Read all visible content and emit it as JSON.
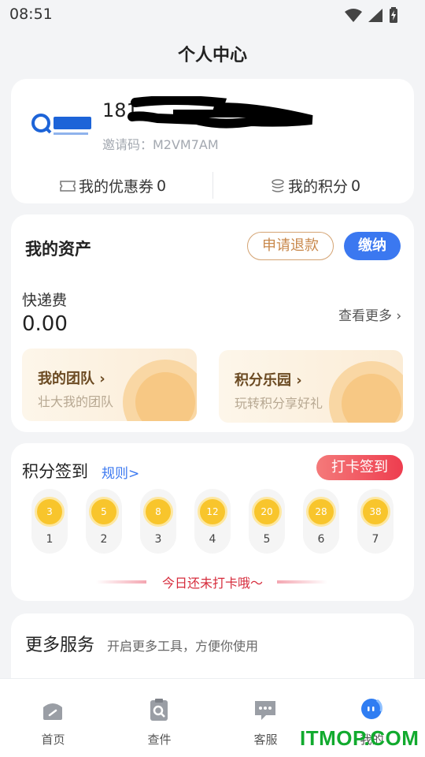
{
  "status_bar": {
    "time": "08:51",
    "icons": [
      "wifi-icon",
      "signal-icon",
      "battery-charging-icon"
    ]
  },
  "page": {
    "title": "个人中心"
  },
  "profile": {
    "phone": "181",
    "invite_code": "邀请码：M2VM7AM",
    "logo_icon": "qbida-logo",
    "coupon_label": "我的优惠券",
    "coupon_count": "0",
    "points_label": "我的积分",
    "points_count": "0"
  },
  "assets": {
    "title": "我的资产",
    "refund_button": "申请退款",
    "pay_button": "缴纳",
    "fee_label": "快递费",
    "fee_value": "0.00",
    "see_more": "查看更多",
    "promos": [
      {
        "title": "我的团队",
        "subtitle": "壮大我的团队"
      },
      {
        "title": "积分乐园",
        "subtitle": "玩转积分享好礼"
      }
    ]
  },
  "checkin": {
    "title": "积分签到",
    "rules_link": "规则>",
    "button": "打卡签到",
    "days": [
      {
        "points": "3",
        "day": "1"
      },
      {
        "points": "5",
        "day": "2"
      },
      {
        "points": "8",
        "day": "3"
      },
      {
        "points": "12",
        "day": "4"
      },
      {
        "points": "20",
        "day": "5"
      },
      {
        "points": "28",
        "day": "6"
      },
      {
        "points": "38",
        "day": "7"
      }
    ],
    "message": "今日还未打卡哦～"
  },
  "services": {
    "title": "更多服务",
    "subtitle": "开启更多工具，方便你使用"
  },
  "tabs": [
    {
      "label": "首页",
      "icon": "home-icon"
    },
    {
      "label": "查件",
      "icon": "package-search-icon"
    },
    {
      "label": "客服",
      "icon": "chat-icon"
    },
    {
      "label": "我的",
      "icon": "profile-icon"
    }
  ],
  "colors": {
    "accent": "#3b78f0",
    "checkin_red": "#ee3d4f",
    "coin_gold": "#f8c52c",
    "refund_border": "#d4a372"
  },
  "watermark": "ITMOP.COM"
}
